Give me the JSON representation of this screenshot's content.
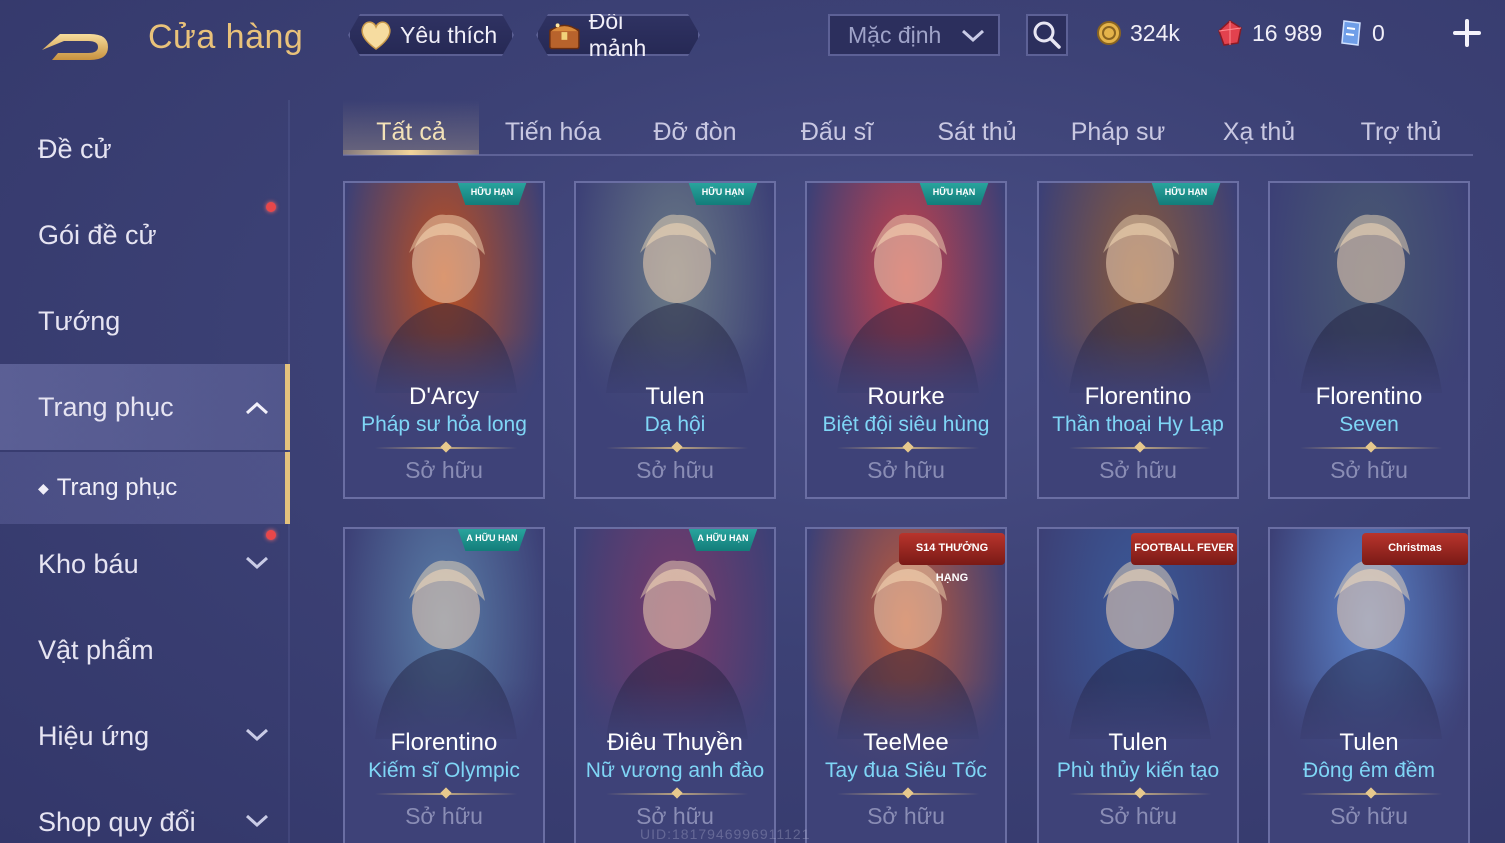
{
  "header": {
    "title": "Cửa hàng",
    "favorites_label": "Yêu thích",
    "exchange_label": "Đổi mảnh",
    "sort_value": "Mặc định",
    "gold": "324k",
    "gems": "16 989",
    "tickets": "0"
  },
  "sidebar": {
    "items": [
      {
        "label": "Đề cử"
      },
      {
        "label": "Gói đề cử"
      },
      {
        "label": "Tướng"
      },
      {
        "label": "Trang phục"
      },
      {
        "label": "Kho báu"
      },
      {
        "label": "Vật phẩm"
      },
      {
        "label": "Hiệu ứng"
      },
      {
        "label": "Shop quy đổi"
      }
    ],
    "sub_item": "Trang phục"
  },
  "tabs": [
    {
      "label": "Tất cả"
    },
    {
      "label": "Tiến hóa"
    },
    {
      "label": "Đỡ đòn"
    },
    {
      "label": "Đấu sĩ"
    },
    {
      "label": "Sát thủ"
    },
    {
      "label": "Pháp sư"
    },
    {
      "label": "Xạ thủ"
    },
    {
      "label": "Trợ thủ"
    }
  ],
  "cards": [
    {
      "hero": "D'Arcy",
      "skin": "Pháp sư hỏa long",
      "status": "Sở hữu",
      "badge": "HỮU HẠN",
      "art": "#c0501f"
    },
    {
      "hero": "Tulen",
      "skin": "Dạ hội",
      "status": "Sở hữu",
      "badge": "HỮU HẠN",
      "art": "#6a7a86"
    },
    {
      "hero": "Rourke",
      "skin": "Biệt đội siêu hùng",
      "status": "Sở hữu",
      "badge": "HỮU HẠN",
      "art": "#c8414a"
    },
    {
      "hero": "Florentino",
      "skin": "Thần thoại Hy Lạp",
      "status": "Sở hữu",
      "badge": "HỮU HẠN",
      "art": "#8a5a3a"
    },
    {
      "hero": "Florentino",
      "skin": "Seven",
      "status": "Sở hữu",
      "badge": "",
      "art": "#4a5a72"
    },
    {
      "hero": "Florentino",
      "skin": "Kiếm sĩ Olympic",
      "status": "Sở hữu",
      "badge": "A HỮU HẠN",
      "art": "#5a7ea8"
    },
    {
      "hero": "Điêu Thuyền",
      "skin": "Nữ vương anh đào",
      "status": "Sở hữu",
      "badge": "A HỮU HẠN",
      "art": "#7a3a6a"
    },
    {
      "hero": "TeeMee",
      "skin": "Tay đua Siêu Tốc",
      "status": "Sở hữu",
      "badge": "S14 THƯỞNG HẠNG",
      "art": "#c05a3a"
    },
    {
      "hero": "Tulen",
      "skin": "Phù thủy kiến tạo",
      "status": "Sở hữu",
      "badge": "FOOTBALL FEVER",
      "art": "#3a5a9a"
    },
    {
      "hero": "Tulen",
      "skin": "Đông êm đềm",
      "status": "Sở hữu",
      "badge": "Christmas",
      "art": "#5a82c8"
    }
  ],
  "watermark": "UID:1817946996911121",
  "colors": {
    "accent_gold": "#e9c27a",
    "skin_name_cyan": "#7fd6f6",
    "notification_red": "#e8474a"
  }
}
